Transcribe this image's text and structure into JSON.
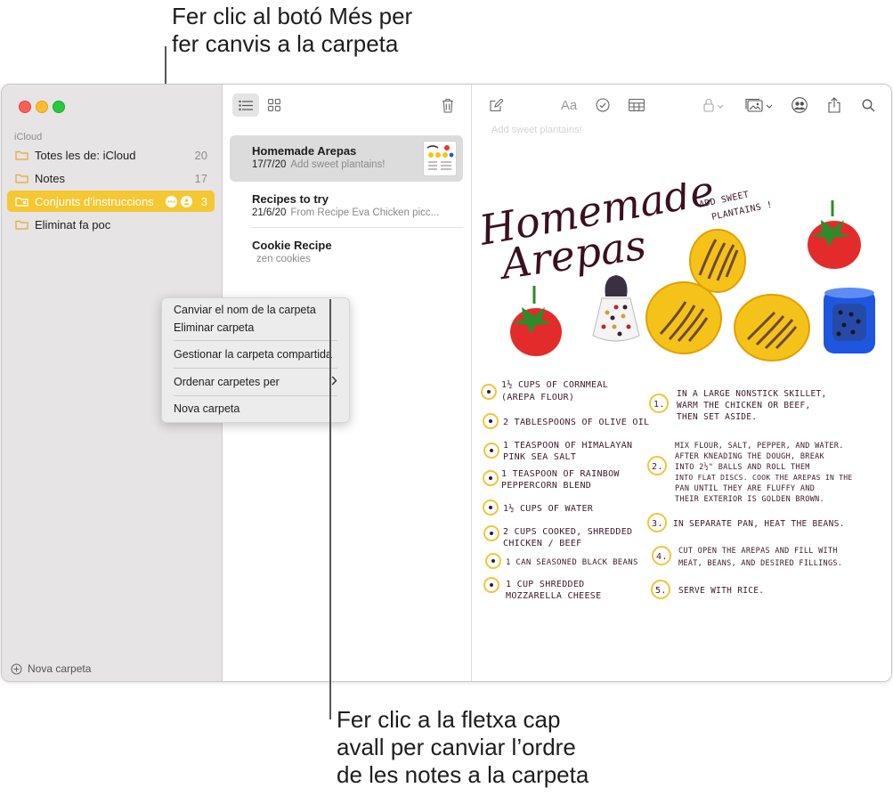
{
  "callouts": {
    "top_line1": "Fer clic al botó Més per",
    "top_line2": "fer canvis a la carpeta",
    "bottom_line1": "Fer clic a la fletxa cap",
    "bottom_line2": "avall per canviar l’ordre",
    "bottom_line3": "de les notes a la carpeta"
  },
  "sidebar": {
    "section": "iCloud",
    "folders": [
      {
        "label": "Totes les de: iCloud",
        "count": "20"
      },
      {
        "label": "Notes",
        "count": "17"
      },
      {
        "label": "Conjunts d’instruccions",
        "count": "3"
      },
      {
        "label": "Eliminat fa poc",
        "count": ""
      }
    ],
    "new_folder": "Nova carpeta"
  },
  "context_menu": {
    "items": [
      "Canviar el nom de la carpeta",
      "Eliminar carpeta",
      "Gestionar la carpeta compartida",
      "Ordenar carpetes per",
      "Nova carpeta"
    ]
  },
  "note_list": {
    "notes": [
      {
        "title": "Homemade Arepas",
        "date": "17/7/20",
        "preview": "Add sweet plantains!"
      },
      {
        "title": "Recipes to try",
        "date": "21/6/20",
        "preview": "From Recipe Eva Chicken picc..."
      },
      {
        "title": "Cookie Recipe",
        "date": "",
        "preview": "zen cookies"
      }
    ]
  },
  "editor": {
    "faded_header": "Add sweet plantains!",
    "title_line1": "Homemade",
    "title_line2": "Arepas",
    "plantains_note_1": "ADD SWEET",
    "plantains_note_2": "PLANTAINS !",
    "ingredients": [
      [
        "1½ CUPS OF CORNMEAL",
        "(AREPA FLOUR)"
      ],
      [
        "2 TABLESPOONS OF OLIVE OIL"
      ],
      [
        "1 TEASPOON OF HIMALAYAN",
        "PINK SEA SALT"
      ],
      [
        "1 TEASPOON OF RAINBOW",
        "PEPPERCORN BLEND"
      ],
      [
        "1½ CUPS OF WATER"
      ],
      [
        "2 CUPS COOKED, SHREDDED",
        "CHICKEN / BEEF"
      ],
      [
        "1 CAN SEASONED BLACK BEANS"
      ],
      [
        "1 CUP SHREDDED",
        "MOZZARELLA CHEESE"
      ]
    ],
    "steps": [
      {
        "num": "1.",
        "lines": [
          "IN A LARGE NONSTICK SKILLET,",
          "WARM THE CHICKEN OR BEEF,",
          "THEN SET ASIDE."
        ]
      },
      {
        "num": "2.",
        "lines": [
          "MIX FLOUR, SALT, PEPPER, AND WATER.",
          "AFTER KNEADING THE DOUGH, BREAK",
          "INTO 2½\" BALLS AND ROLL THEM",
          "INTO FLAT DISCS. COOK THE AREPAS IN THE",
          "PAN UNTIL THEY ARE FLUFFY AND",
          "THEIR EXTERIOR IS GOLDEN BROWN."
        ]
      },
      {
        "num": "3.",
        "lines": [
          "IN SEPARATE PAN, HEAT THE BEANS."
        ]
      },
      {
        "num": "4.",
        "lines": [
          "CUT OPEN THE AREPAS AND FILL WITH",
          "MEAT, BEANS, AND DESIRED FILLINGS."
        ]
      },
      {
        "num": "5.",
        "lines": [
          "SERVE WITH RICE."
        ]
      }
    ]
  },
  "colors": {
    "accent": "#f5c733",
    "sidebar_bg": "#e6e4e4",
    "selected_note_bg": "#dcdcdc"
  }
}
